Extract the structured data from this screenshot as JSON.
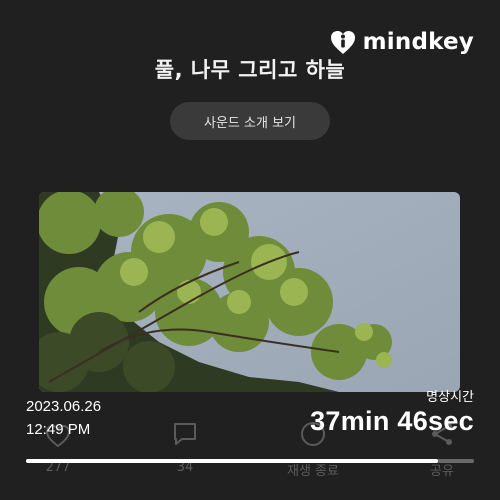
{
  "brand": {
    "name": "mindkey",
    "logo_icon": "info-heart-icon"
  },
  "content": {
    "title": "풀, 나무 그리고 하늘",
    "sound_intro_label": "사운드 소개 보기",
    "image_subject": "tree-against-sky"
  },
  "actions": [
    {
      "icon": "heart-icon",
      "label": "277"
    },
    {
      "icon": "comment-icon",
      "label": "34"
    },
    {
      "icon": "stop-play-icon",
      "label": "재생 종료"
    },
    {
      "icon": "share-icon",
      "label": "공유"
    }
  ],
  "session": {
    "date": "2023.06.26",
    "time": "12:49 PM",
    "meditation_label": "명상시간",
    "meditation_value": "37min 46sec"
  },
  "progress": {
    "fraction": 0.92,
    "fill_color": "#ffffff",
    "track_color": "#6a6a6a"
  },
  "colors": {
    "background": "#202020",
    "button_bg": "#3a3a3a"
  }
}
